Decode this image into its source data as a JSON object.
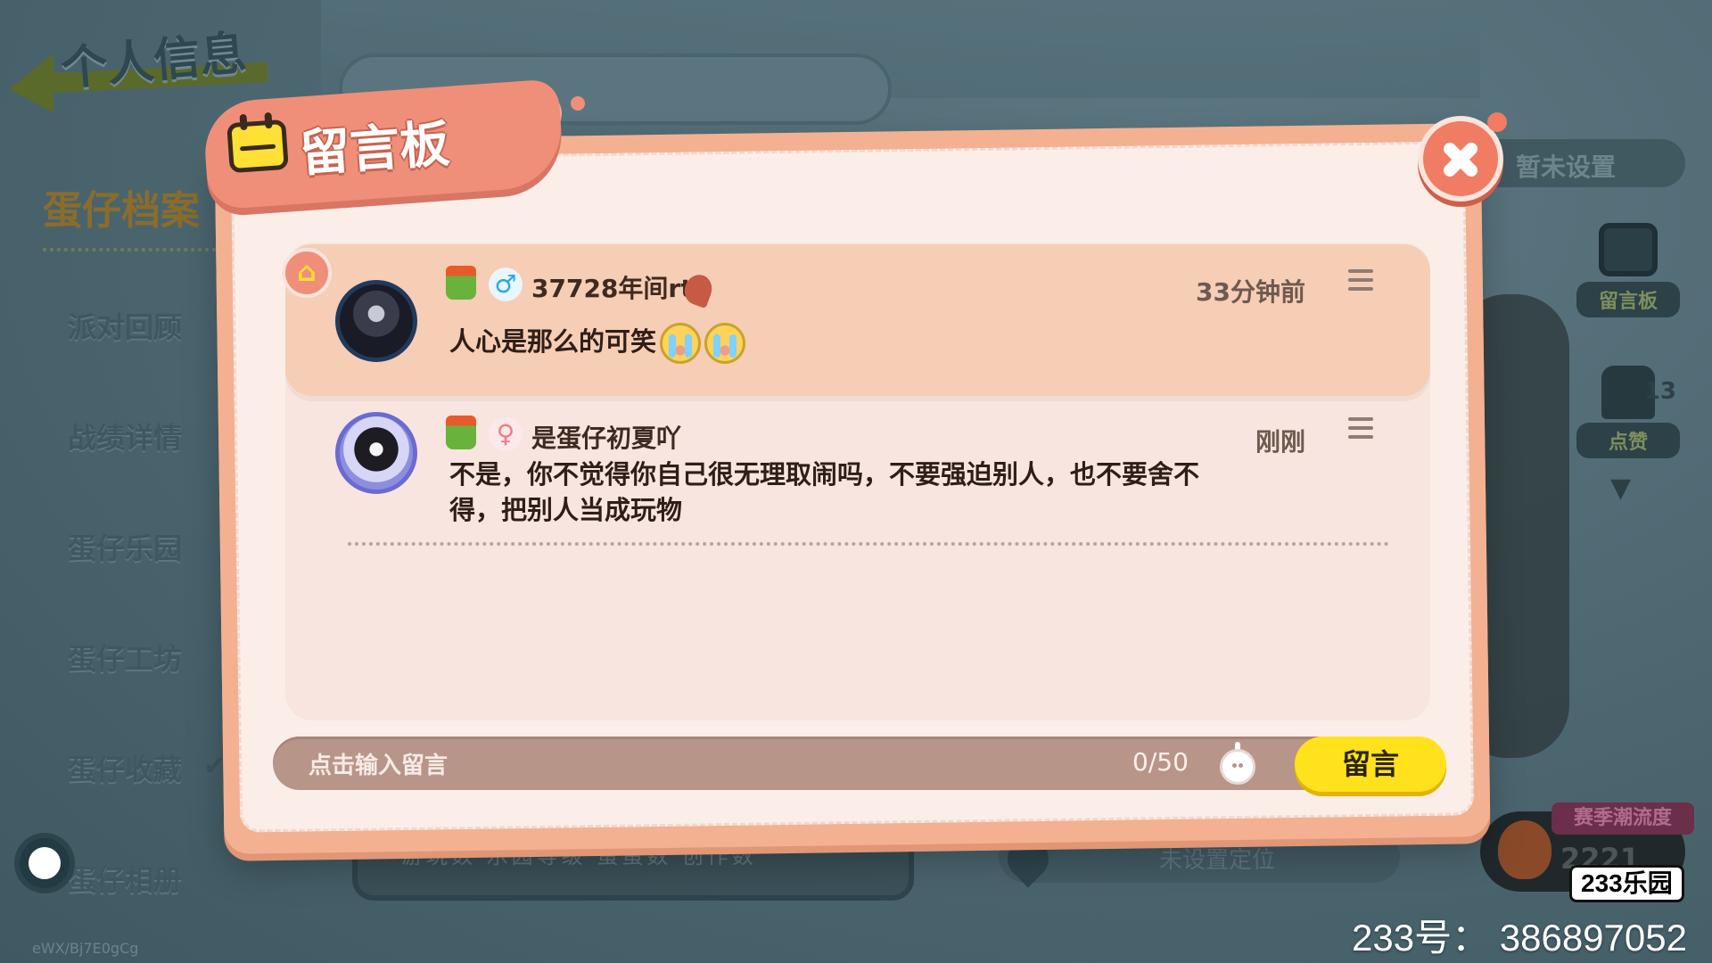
{
  "background": {
    "page_title": "个人信息",
    "sidebar": {
      "header": "蛋仔档案",
      "items": [
        {
          "label": "派对回顾"
        },
        {
          "label": "战绩详情"
        },
        {
          "label": "蛋仔乐园"
        },
        {
          "label": "蛋仔工坊"
        },
        {
          "label": "蛋仔收藏"
        },
        {
          "label": "蛋仔相册"
        }
      ]
    },
    "stats_text": "游玩数  乐园等级  蛋蛋数  创作数",
    "location_text": "未设置定位",
    "unset_text": "暂未设置",
    "right_buttons": {
      "board_label": "留言板",
      "like_label": "点赞",
      "like_count": "13"
    },
    "season_label": "赛季潮流度",
    "season_value": "2221",
    "watermark_small": "eWX/Bj7E0gCg"
  },
  "dialog": {
    "title": "留言板",
    "messages": [
      {
        "pinned": true,
        "username": "37728年间rt",
        "gender": "♂",
        "time": "33分钟前",
        "text": "人心是那么的可笑"
      },
      {
        "pinned": false,
        "username": "是蛋仔初夏吖",
        "gender": "♀",
        "time": "刚刚",
        "text_line1": "不是，你不觉得你自己很无理取闹吗，不要强迫别人，也不要舍不",
        "text_line2": "得，把别人当成玩物"
      }
    ],
    "input": {
      "placeholder": "点击输入留言",
      "count": "0/50"
    },
    "send_label": "留言"
  },
  "overlay": {
    "brand": "233乐园",
    "user_id": "233号： 386897052"
  },
  "colors": {
    "dialog_frame": "#f3b191",
    "title_tab": "#f08f79",
    "pinned_card": "#f6cdb5",
    "send_button": "#ffe21c",
    "input_bar": "#b79689"
  }
}
